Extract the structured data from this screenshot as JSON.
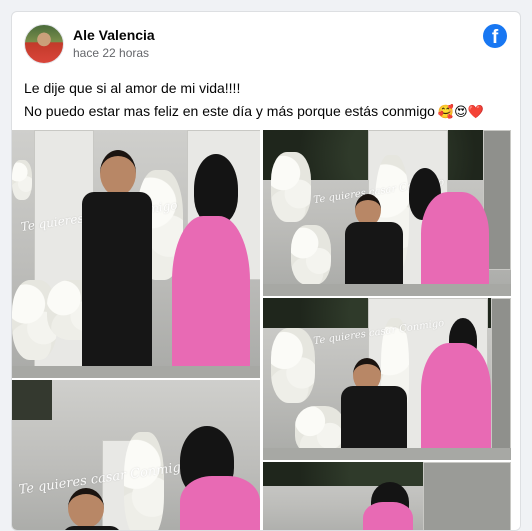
{
  "post": {
    "author": "Ale Valencia",
    "time": "hace 22 horas",
    "line1": "Le dije que si al amor de mi vida!!!!",
    "line2": "No puedo estar mas feliz en este día y más porque estás conmigo",
    "emojis": "🥰😍❤️"
  },
  "icons": {
    "facebook": "facebook-logo-icon"
  },
  "photos": {
    "sign_text": "Te quieres casar Conmigo"
  },
  "colors": {
    "facebook_blue": "#1877f2",
    "dress_pink": "#e86ab4"
  }
}
